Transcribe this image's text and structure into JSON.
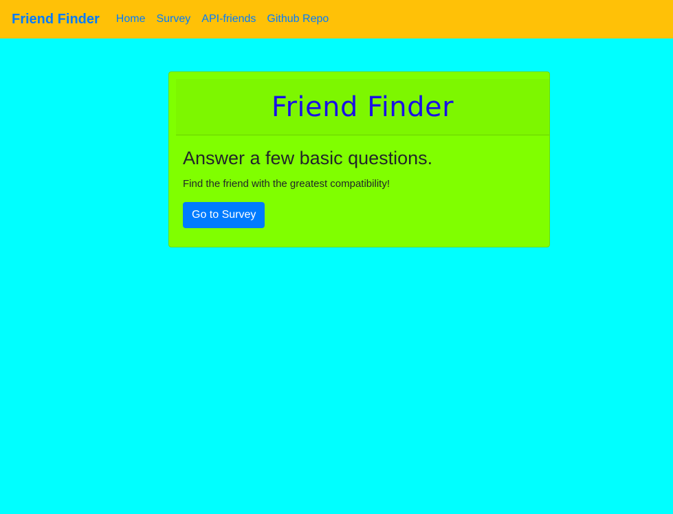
{
  "navbar": {
    "brand": "Friend Finder",
    "links": [
      {
        "label": "Home"
      },
      {
        "label": "Survey"
      },
      {
        "label": "API-friends"
      },
      {
        "label": "Github Repo"
      }
    ]
  },
  "card": {
    "header_title": "Friend Finder",
    "heading": "Answer a few basic questions.",
    "text": "Find the friend with the greatest compatibility!",
    "button_label": "Go to Survey"
  },
  "colors": {
    "page_background": "#00FFFF",
    "navbar_background": "#FFC107",
    "card_background": "#80FF00",
    "link_color": "#007BFF",
    "title_color": "#1A10E6",
    "button_background": "#007BFF"
  }
}
